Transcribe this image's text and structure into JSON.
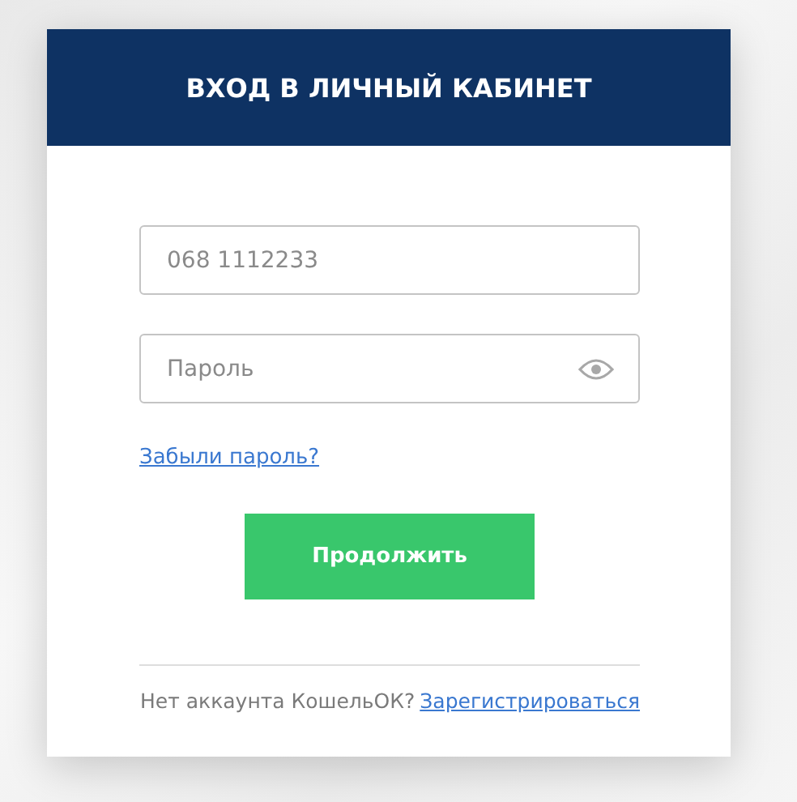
{
  "header": {
    "title": "ВХОД В ЛИЧНЫЙ КАБИНЕТ"
  },
  "fields": [
    {
      "kind": "text",
      "placeholder": "068 1112233"
    },
    {
      "kind": "password",
      "placeholder": "Пароль"
    }
  ],
  "forgot_link": "Забыли пароль?",
  "submit_button": "Продолжить",
  "footer": {
    "text": "Нет аккаунта КошельОК?",
    "link": "Зарегистрироваться"
  }
}
